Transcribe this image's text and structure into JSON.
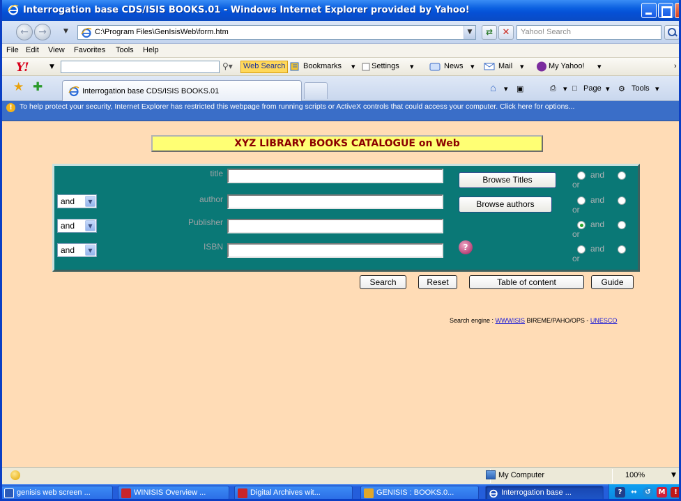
{
  "window": {
    "title": "Interrogation base CDS/ISIS BOOKS.01 - Windows Internet Explorer provided by Yahoo!"
  },
  "address_bar": {
    "url": "C:\\Program Files\\GenIsisWeb\\form.htm",
    "search_placeholder": "Yahoo! Search"
  },
  "menu": [
    "File",
    "Edit",
    "View",
    "Favorites",
    "Tools",
    "Help"
  ],
  "yahoo_toolbar": {
    "web_search_label": "Web Search",
    "bookmarks": "Bookmarks",
    "settings": "Settings",
    "news": "News",
    "mail": "Mail",
    "my_yahoo": "My Yahoo!"
  },
  "tab": {
    "label": "Interrogation base CDS/ISIS BOOKS.01",
    "page_label": "Page",
    "tools_label": "Tools"
  },
  "info_bar": {
    "message": "To help protect your security, Internet Explorer has restricted this webpage from running scripts or ActiveX controls that could access your computer. Click here for options..."
  },
  "page": {
    "banner": "XYZ LIBRARY BOOKS CATALOGUE on Web",
    "rows": [
      {
        "operator": "",
        "label": "title",
        "button": "Browse Titles",
        "radio_and": "and",
        "radio_or": "or"
      },
      {
        "operator": "and",
        "label": "author",
        "button": "Browse authors",
        "radio_and": "and",
        "radio_or": "or"
      },
      {
        "operator": "and",
        "label": "Publisher",
        "button": "",
        "radio_and": "and",
        "radio_or": "or"
      },
      {
        "operator": "and",
        "label": "ISBN",
        "button": "",
        "radio_and": "and",
        "radio_or": "or"
      }
    ],
    "actions": {
      "search": "Search",
      "reset": "Reset",
      "toc": "Table of content",
      "guide": "Guide"
    },
    "engine": {
      "prefix": "Search engine : ",
      "link1": "WWWISIS",
      "middle": " BIREME/PAHO/OPS - ",
      "link2": "UNESCO"
    }
  },
  "status_bar": {
    "zone": "My Computer",
    "zoom": "100%"
  },
  "taskbar": [
    "genisis web screen ...",
    "WINISIS Overview ...",
    "Digital Archives wit...",
    "GENISIS : BOOKS.0...",
    "Interrogation base ..."
  ]
}
